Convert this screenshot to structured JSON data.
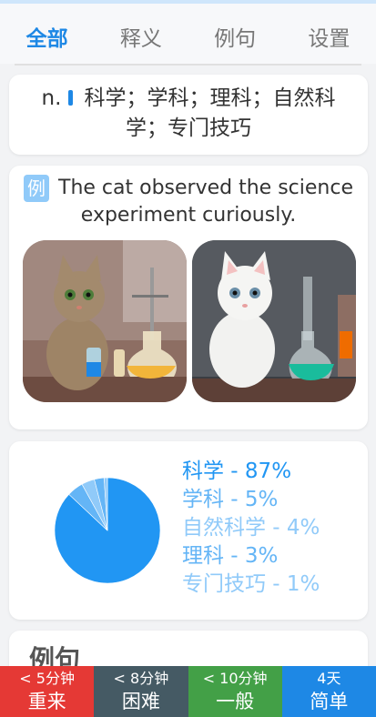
{
  "tabs": [
    "全部",
    "释义",
    "例句",
    "设置"
  ],
  "definition": {
    "pos": "n.",
    "line1": "科学；学科；理科；自然科",
    "line2": "学；专门技巧"
  },
  "example": {
    "badge": "例",
    "line1": "The cat observed the science",
    "line2": "experiment curiously."
  },
  "chart_data": {
    "type": "pie",
    "categories": [
      "科学",
      "学科",
      "自然科学",
      "理科",
      "专门技巧"
    ],
    "values": [
      87,
      5,
      4,
      3,
      1
    ],
    "labels": [
      "科学 - 87%",
      "学科 - 5%",
      "自然科学 - 4%",
      "理科 - 3%",
      "专门技巧 - 1%"
    ],
    "colors": [
      "#2196f3",
      "#64b5f6",
      "#90caf9",
      "#64b5f6",
      "#90caf9"
    ],
    "legend": "right"
  },
  "section": {
    "title": "例句"
  },
  "rating": [
    {
      "sub": "< 5分钟",
      "main": "重来",
      "color": "#e53935"
    },
    {
      "sub": "< 8分钟",
      "main": "困难",
      "color": "#455a64"
    },
    {
      "sub": "< 10分钟",
      "main": "一般",
      "color": "#43a047"
    },
    {
      "sub": "4天",
      "main": "简单",
      "color": "#1e88e5"
    }
  ],
  "colors": {
    "accent": "#1e88e5",
    "background": "#f2f3f5"
  }
}
